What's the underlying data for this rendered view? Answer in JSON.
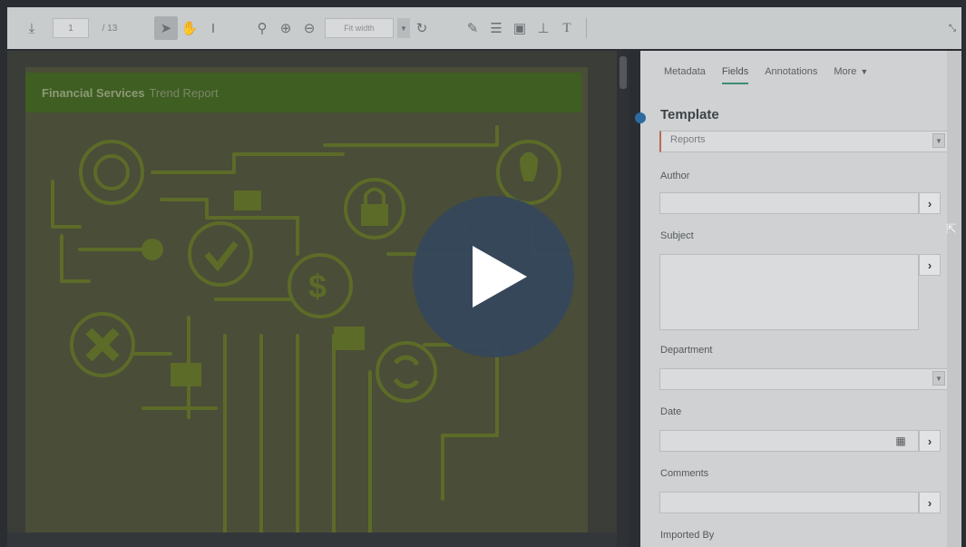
{
  "toolbar": {
    "page_number": "1",
    "page_count": "/ 13",
    "zoom": "Fit width",
    "icons": [
      "download-icon",
      "select-arrow-icon",
      "hand-icon",
      "text-cursor-icon",
      "search-icon",
      "zoom-in-icon",
      "zoom-out-icon",
      "rotate-icon",
      "pen-icon",
      "redact-icon",
      "save-icon",
      "stamp-icon",
      "text-icon"
    ]
  },
  "document": {
    "title_strong": "Financial Services",
    "title_light": "Trend Report"
  },
  "panel": {
    "tabs": [
      {
        "label": "Metadata",
        "active": false
      },
      {
        "label": "Fields",
        "active": true
      },
      {
        "label": "Annotations",
        "active": false
      },
      {
        "label": "More",
        "active": false
      }
    ],
    "template_label": "Template",
    "template_value": "Reports",
    "author_label": "Author",
    "subject_label": "Subject",
    "department_label": "Department",
    "date_label": "Date",
    "comments_label": "Comments",
    "imported_by_label": "Imported By"
  },
  "colors": {
    "doc_header": "#3f5e22",
    "tab_underline": "#3e8c72",
    "play_button": "#34465c"
  }
}
